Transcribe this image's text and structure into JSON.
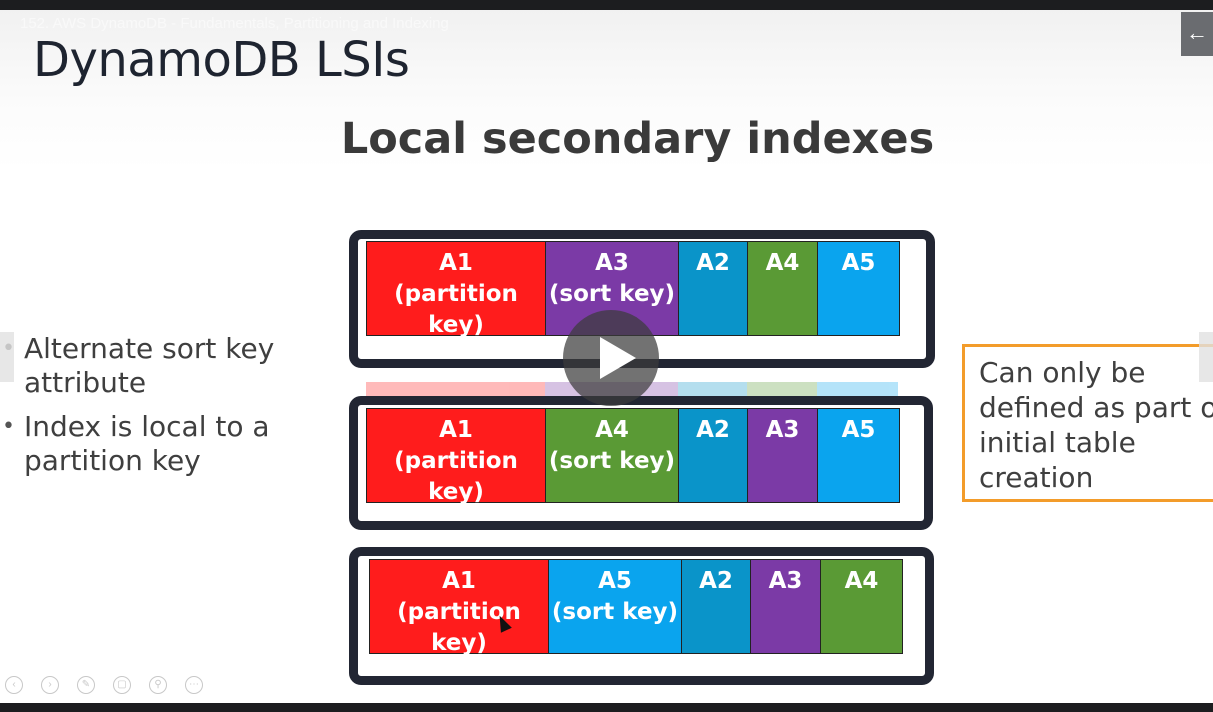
{
  "video": {
    "title": "152. AWS DynamoDB - Fundamentals, Partitioning and Indexing"
  },
  "slide": {
    "title": "DynamoDB LSIs",
    "subtitle": "Local secondary indexes",
    "bullets": [
      "Alternate sort key attribute",
      "Index is local to a partition key"
    ],
    "callout": "Can only be defined as part of initial table creation"
  },
  "tables": [
    {
      "cells": [
        {
          "label": "A1\n(partition\nkey)",
          "color": "#ff1c1c"
        },
        {
          "label": "A3\n(sort key)",
          "color": "#7b3aa6"
        },
        {
          "label": "A2",
          "color": "#0a94c9"
        },
        {
          "label": "A4",
          "color": "#5a9a35"
        },
        {
          "label": "A5",
          "color": "#0aa4ee"
        }
      ]
    },
    {
      "cells": [
        {
          "label": "A1\n(partition\nkey)",
          "color": "#ff1c1c"
        },
        {
          "label": "A4\n(sort key)",
          "color": "#5a9a35"
        },
        {
          "label": "A2",
          "color": "#0a94c9"
        },
        {
          "label": "A3",
          "color": "#7b3aa6"
        },
        {
          "label": "A5",
          "color": "#0aa4ee"
        }
      ]
    },
    {
      "cells": [
        {
          "label": "A1\n(partition\nkey)",
          "color": "#ff1c1c"
        },
        {
          "label": "A5\n(sort key)",
          "color": "#0aa4ee"
        },
        {
          "label": "A2",
          "color": "#0a94c9"
        },
        {
          "label": "A3",
          "color": "#7b3aa6"
        },
        {
          "label": "A4",
          "color": "#5a9a35"
        }
      ]
    }
  ],
  "icons": {
    "back": "back-arrow-icon",
    "play": "play-icon",
    "toolbar": [
      "previous-icon",
      "next-icon",
      "pen-icon",
      "copy-icon",
      "zoom-icon",
      "more-icon"
    ]
  },
  "colors": {
    "callout_border": "#f39c2a",
    "frame": "#222633"
  }
}
